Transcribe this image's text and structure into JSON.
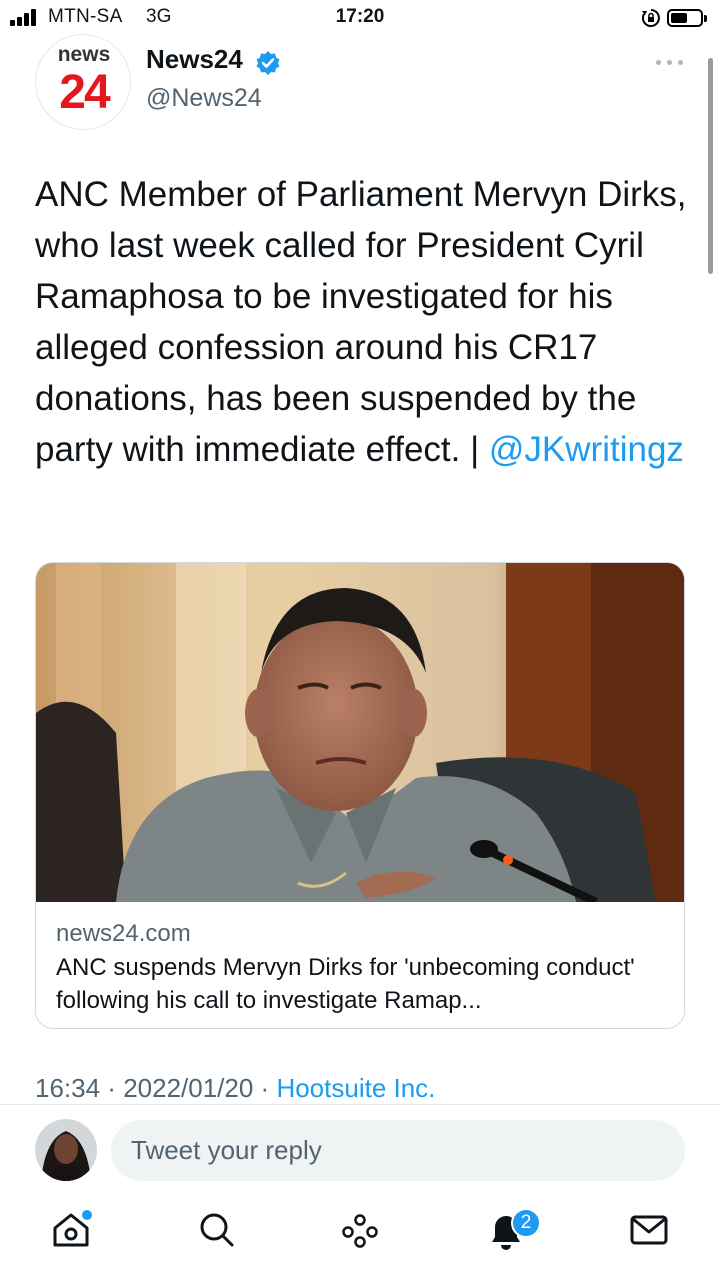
{
  "status_bar": {
    "carrier": "MTN-SA",
    "network": "3G",
    "time": "17:20"
  },
  "tweet": {
    "author": {
      "avatar_top": "news",
      "avatar_bottom": "24",
      "name": "News24",
      "handle": "@News24",
      "verified": true
    },
    "text": "ANC Member of Parliament Mervyn Dirks, who last week called for President Cyril Ramaphosa to be investigated for his alleged confession around his CR17 donations, has been suspended by the party with immediate effect. | ",
    "mention": "@JKwritingz",
    "card": {
      "domain": "news24.com",
      "title": "ANC suspends Mervyn Dirks for 'unbecoming conduct' following his call to investigate Ramap..."
    },
    "time": "16:34",
    "date": "2022/01/20",
    "source": "Hootsuite Inc."
  },
  "reply": {
    "placeholder": "Tweet your reply"
  },
  "tab_bar": {
    "notifications_count": "2"
  },
  "icons": {
    "home": "home-icon",
    "search": "search-icon",
    "spaces": "spaces-icon",
    "notifications": "bell-icon",
    "messages": "mail-icon"
  },
  "colors": {
    "accent": "#1d9bf0",
    "brand_red": "#e3171e",
    "secondary_text": "#536471"
  }
}
